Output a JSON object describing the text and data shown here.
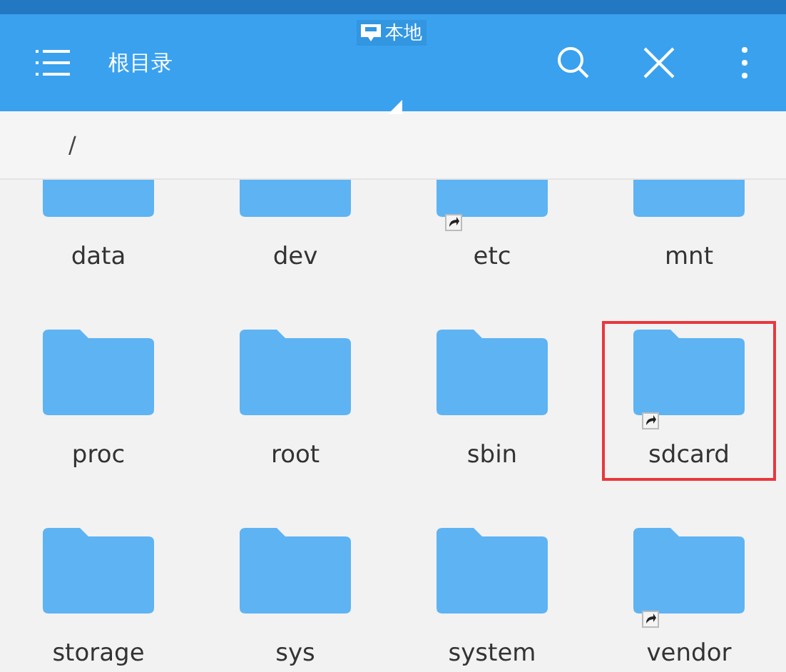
{
  "toolbar": {
    "source_tab": "本地",
    "title": "根目录"
  },
  "path": "/",
  "folders": [
    {
      "name": "data",
      "shortcut": false,
      "highlighted": false
    },
    {
      "name": "dev",
      "shortcut": false,
      "highlighted": false
    },
    {
      "name": "etc",
      "shortcut": true,
      "highlighted": false
    },
    {
      "name": "mnt",
      "shortcut": false,
      "highlighted": false
    },
    {
      "name": "proc",
      "shortcut": false,
      "highlighted": false
    },
    {
      "name": "root",
      "shortcut": false,
      "highlighted": false
    },
    {
      "name": "sbin",
      "shortcut": false,
      "highlighted": false
    },
    {
      "name": "sdcard",
      "shortcut": true,
      "highlighted": true
    },
    {
      "name": "storage",
      "shortcut": false,
      "highlighted": false
    },
    {
      "name": "sys",
      "shortcut": false,
      "highlighted": false
    },
    {
      "name": "system",
      "shortcut": false,
      "highlighted": false
    },
    {
      "name": "vendor",
      "shortcut": true,
      "highlighted": false
    }
  ]
}
